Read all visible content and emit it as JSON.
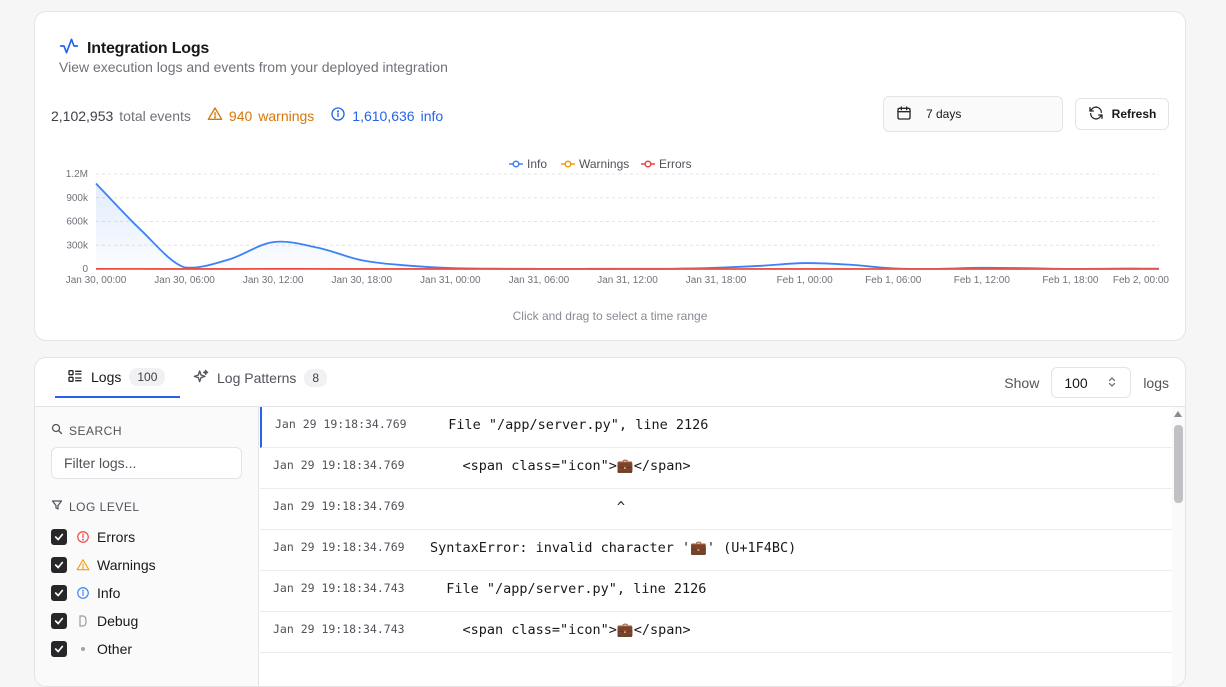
{
  "header": {
    "title": "Integration Logs",
    "subtitle": "View execution logs and events from your deployed integration"
  },
  "stats": {
    "total_value": "2,102,953",
    "total_label": "total events",
    "warnings_value": "940",
    "warnings_label": "warnings",
    "info_value": "1,610,636",
    "info_label": "info"
  },
  "controls": {
    "date_range": "7 days",
    "refresh_label": "Refresh"
  },
  "chart_hint": "Click and drag to select a time range",
  "colors": {
    "info": "#3b82f6",
    "warnings": "#f59e0b",
    "errors": "#ef4444",
    "accent": "#2563eb"
  },
  "chart_data": {
    "type": "line",
    "legend_position": "top-center",
    "grid": true,
    "y_ticks": [
      "0",
      "300k",
      "600k",
      "900k",
      "1.2M"
    ],
    "ylim": [
      0,
      1200000
    ],
    "x_ticks": [
      "Jan 30, 00:00",
      "Jan 30, 06:00",
      "Jan 30, 12:00",
      "Jan 30, 18:00",
      "Jan 31, 00:00",
      "Jan 31, 06:00",
      "Jan 31, 12:00",
      "Jan 31, 18:00",
      "Feb 1, 00:00",
      "Feb 1, 06:00",
      "Feb 1, 12:00",
      "Feb 1, 18:00",
      "Feb 2, 00:00"
    ],
    "x_hours": [
      0,
      3,
      6,
      9,
      12,
      15,
      18,
      21,
      24,
      27,
      30,
      33,
      36,
      39,
      42,
      45,
      48,
      51,
      54,
      57,
      60,
      63,
      66,
      69,
      72
    ],
    "series": [
      {
        "name": "Info",
        "values": [
          1080000,
          500000,
          20000,
          120000,
          340000,
          270000,
          110000,
          45000,
          12000,
          4000,
          2000,
          2000,
          3000,
          3000,
          15000,
          40000,
          75000,
          55000,
          8000,
          2000,
          15000,
          10000,
          2000,
          5000,
          5000
        ]
      },
      {
        "name": "Warnings",
        "values": [
          1000,
          800,
          200,
          500,
          900,
          700,
          400,
          200,
          100,
          50,
          30,
          30,
          30,
          30,
          50,
          100,
          150,
          100,
          30,
          20,
          40,
          30,
          20,
          20,
          20
        ]
      },
      {
        "name": "Errors",
        "values": [
          2000,
          1500,
          500,
          1000,
          2000,
          1500,
          800,
          400,
          200,
          100,
          50,
          50,
          50,
          50,
          100,
          200,
          300,
          200,
          50,
          30,
          80,
          60,
          30,
          30,
          30
        ]
      }
    ]
  },
  "tabs": [
    {
      "label": "Logs",
      "count": "100"
    },
    {
      "label": "Log Patterns",
      "count": "8"
    }
  ],
  "show": {
    "label": "Show",
    "value": "100",
    "suffix": "logs"
  },
  "sidebar": {
    "search_heading": "SEARCH",
    "filter_placeholder": "Filter logs...",
    "level_heading": "LOG LEVEL",
    "levels": [
      {
        "label": "Errors",
        "checked": true,
        "icon": "alert-circle-icon"
      },
      {
        "label": "Warnings",
        "checked": true,
        "icon": "alert-triangle-icon"
      },
      {
        "label": "Info",
        "checked": true,
        "icon": "info-icon"
      },
      {
        "label": "Debug",
        "checked": true,
        "icon": "debug-icon"
      },
      {
        "label": "Other",
        "checked": true,
        "icon": "dot-icon"
      }
    ]
  },
  "logs": [
    {
      "time": "Jan 29 19:18:34.769",
      "message": "  File \"/app/server.py\", line 2126"
    },
    {
      "time": "Jan 29 19:18:34.769",
      "message": "    <span class=\"icon\">💼</span>"
    },
    {
      "time": "Jan 29 19:18:34.769",
      "message": "                       ^"
    },
    {
      "time": "Jan 29 19:18:34.769",
      "message": "SyntaxError: invalid character '💼' (U+1F4BC)"
    },
    {
      "time": "Jan 29 19:18:34.743",
      "message": "  File \"/app/server.py\", line 2126"
    },
    {
      "time": "Jan 29 19:18:34.743",
      "message": "    <span class=\"icon\">💼</span>"
    }
  ]
}
